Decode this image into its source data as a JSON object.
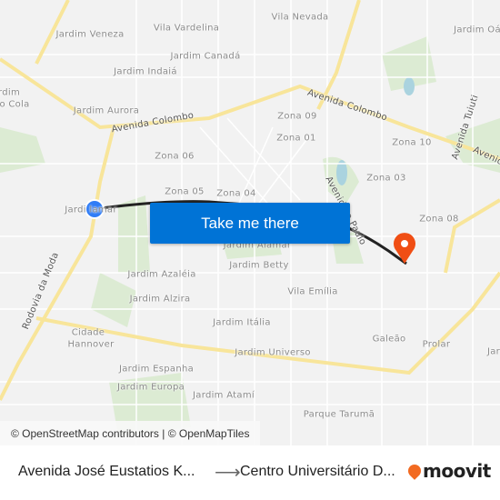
{
  "map": {
    "labels": {
      "vila_vardelina": "Vila Vardelina",
      "vila_nevada": "Vila Nevada",
      "jardim_veneza": "Jardim Veneza",
      "jardim_canada": "Jardim Canadá",
      "jardim_oa": "Jardim Oá",
      "jardim_indaia": "Jardim Indaiá",
      "rdim": "rdim",
      "o_cola": "o Cola",
      "jardim_aurora": "Jardim Aurora",
      "avenida_colombo_1": "Avenida Colombo",
      "avenida_colombo_2": "Avenida Colombo",
      "zona_09": "Zona 09",
      "zona_01": "Zona 01",
      "zona_10": "Zona 10",
      "avenida_tuiuti": "Avenida Tuiuti",
      "avenid": "Avenid",
      "zona_06": "Zona 06",
      "zona_03": "Zona 03",
      "zona_05": "Zona 05",
      "zona_04": "Zona 04",
      "zona_08": "Zona 08",
      "jardi_alamar": "Jardi    lamar",
      "jardim_alamar": "Jardim Alamar",
      "jardim_betty": "Jardim Betty",
      "jardim_azaleia": "Jardim Azaléia",
      "jardim_alzira": "Jardim Alzira",
      "vila_emilia": "Vila Emília",
      "jardim_italia": "Jardim Itália",
      "cidade": "Cidade",
      "hannover": "Hannover",
      "jardim_universo": "Jardim Universo",
      "galeao": "Galeão",
      "prolar": "Prolar",
      "jar": "Jar",
      "jardim_espanha": "Jardim Espanha",
      "jardim_europa": "Jardim Europa",
      "jardim_atami": "Jardim Atamí",
      "parque_taruma": "Parque Tarumã",
      "rodovia_da_moda": "Rodovia da Moda",
      "avenida_paulo": "Avenida    o Paulo"
    },
    "origin_color": "#2f7cf6",
    "destination_color": "#f04e14",
    "route_color": "#222222",
    "cta_label": "Take me there",
    "attribution": "© OpenStreetMap contributors | © OpenMapTiles"
  },
  "footer": {
    "from": "Avenida José Eustatios K...",
    "arrow": "⟶",
    "to": "Centro Universitário D...",
    "logo": "moovit"
  }
}
